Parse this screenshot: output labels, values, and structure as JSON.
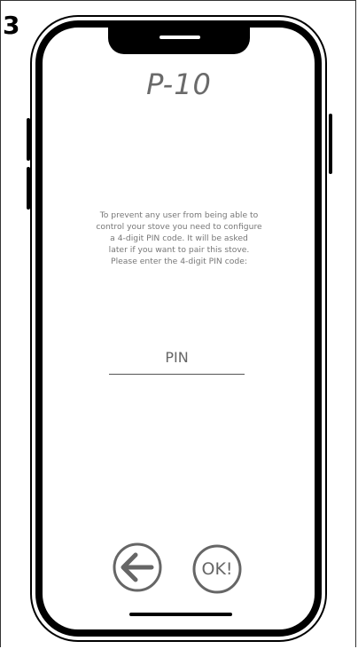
{
  "step_number": "3",
  "screen": {
    "title": "P-10",
    "instructions": "To prevent any user from being able to\ncontrol your stove you need to configure\na 4-digit PIN code. It will be asked\nlater if you want to pair this stove.\nPlease enter the 4-digit PIN code:",
    "pin_input": {
      "placeholder": "PIN",
      "value": ""
    },
    "buttons": {
      "back_icon": "arrow-left-circle-icon",
      "ok_label": "OK!"
    }
  },
  "colors": {
    "outline": "#000000",
    "text_gray": "#666666",
    "background": "#ffffff"
  }
}
